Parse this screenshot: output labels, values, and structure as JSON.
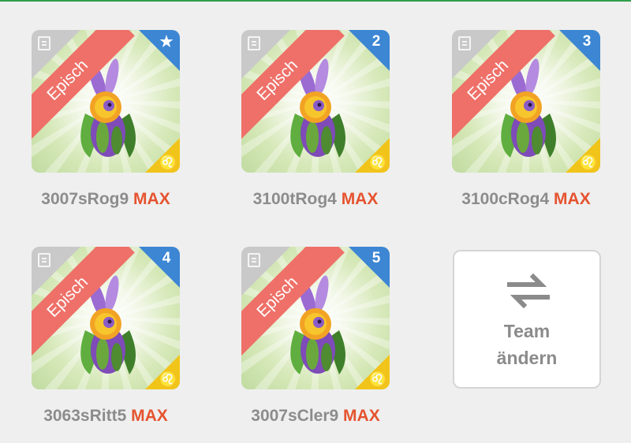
{
  "colors": {
    "background": "#efefef",
    "ribbon": "#ee7068",
    "badge_blue": "#3c86d4",
    "badge_yellow": "#f1c41a",
    "max_accent": "#e5532f",
    "label_grey": "#8c8c8c"
  },
  "team": [
    {
      "rarity": "Episch",
      "slot": "★",
      "slot_icon": "star-icon",
      "element": "♌",
      "element_icon": "leo-icon",
      "name": "3007sRog9",
      "level": "MAX"
    },
    {
      "rarity": "Episch",
      "slot": "2",
      "element": "♌",
      "element_icon": "leo-icon",
      "name": "3100tRog4",
      "level": "MAX"
    },
    {
      "rarity": "Episch",
      "slot": "3",
      "element": "♌",
      "element_icon": "leo-icon",
      "name": "3100cRog4",
      "level": "MAX"
    },
    {
      "rarity": "Episch",
      "slot": "4",
      "element": "♌",
      "element_icon": "leo-icon",
      "name": "3063sRitt5",
      "level": "MAX"
    },
    {
      "rarity": "Episch",
      "slot": "5",
      "element": "♌",
      "element_icon": "leo-icon",
      "name": "3007sCler9",
      "level": "MAX"
    }
  ],
  "change_team": {
    "line1": "Team",
    "line2": "ändern",
    "icon": "swap-arrows-icon"
  }
}
